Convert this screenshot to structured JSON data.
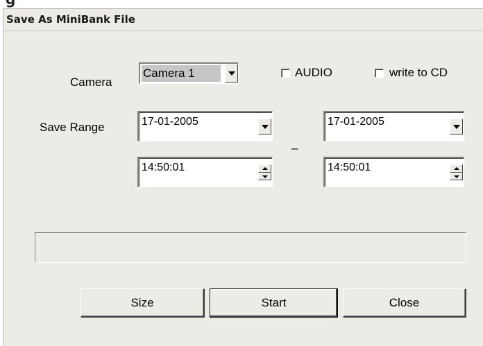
{
  "window": {
    "title": "Save As MiniBank File"
  },
  "camera": {
    "label": "Camera",
    "selected": "Camera 1"
  },
  "options": {
    "audio_label": "AUDIO",
    "write_cd_label": "write to CD"
  },
  "save_range": {
    "label": "Save Range",
    "separator": "–",
    "from_date": "17-01-2005",
    "from_time": "14:50:01",
    "to_date": "17-01-2005",
    "to_time": "14:50:01"
  },
  "progress": {
    "value": 0
  },
  "buttons": {
    "size": "Size",
    "start": "Start",
    "close": "Close"
  }
}
